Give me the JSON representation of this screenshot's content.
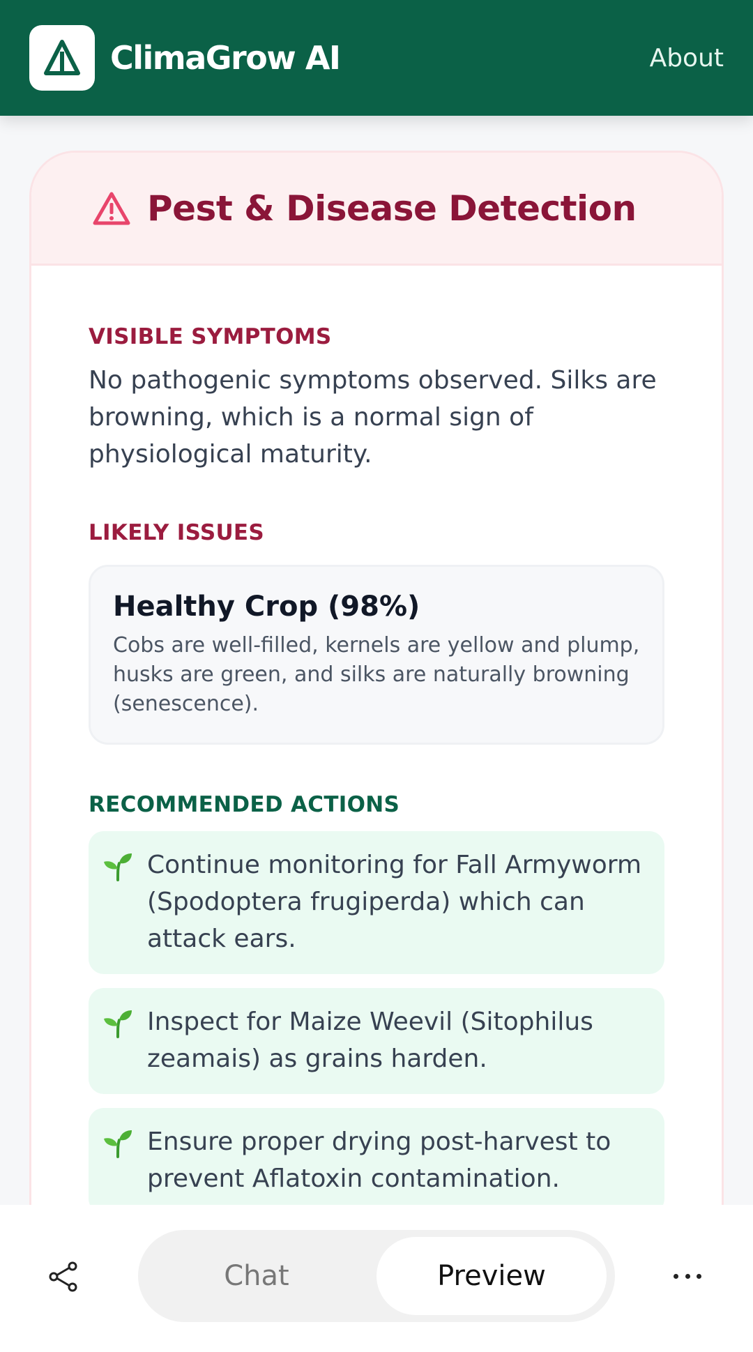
{
  "header": {
    "app_title": "ClimaGrow AI",
    "about_label": "About",
    "brand_color": "#0b6147"
  },
  "card": {
    "title": "Pest & Disease Detection",
    "icon": "warning-triangle-icon",
    "accent_color": "#9b1c3f",
    "visible_symptoms": {
      "label": "VISIBLE SYMPTOMS",
      "text": "No pathogenic symptoms observed. Silks are browning, which is a normal sign of physiological maturity."
    },
    "likely_issues": {
      "label": "LIKELY ISSUES",
      "items": [
        {
          "title": "Healthy Crop (98%)",
          "description": "Cobs are well-filled, kernels are yellow and plump, husks are green, and silks are naturally browning (senescence)."
        }
      ]
    },
    "recommended_actions": {
      "label": "RECOMMENDED ACTIONS",
      "icon": "seedling-icon",
      "items": [
        "Continue monitoring for Fall Armyworm (Spodoptera frugiperda) which can attack ears.",
        "Inspect for Maize Weevil (Sitophilus zeamais) as grains harden.",
        "Ensure proper drying post-harvest to prevent Aflatoxin contamination."
      ]
    }
  },
  "bottom_bar": {
    "tabs": [
      "Chat",
      "Preview"
    ],
    "selected_tab": "Preview"
  }
}
